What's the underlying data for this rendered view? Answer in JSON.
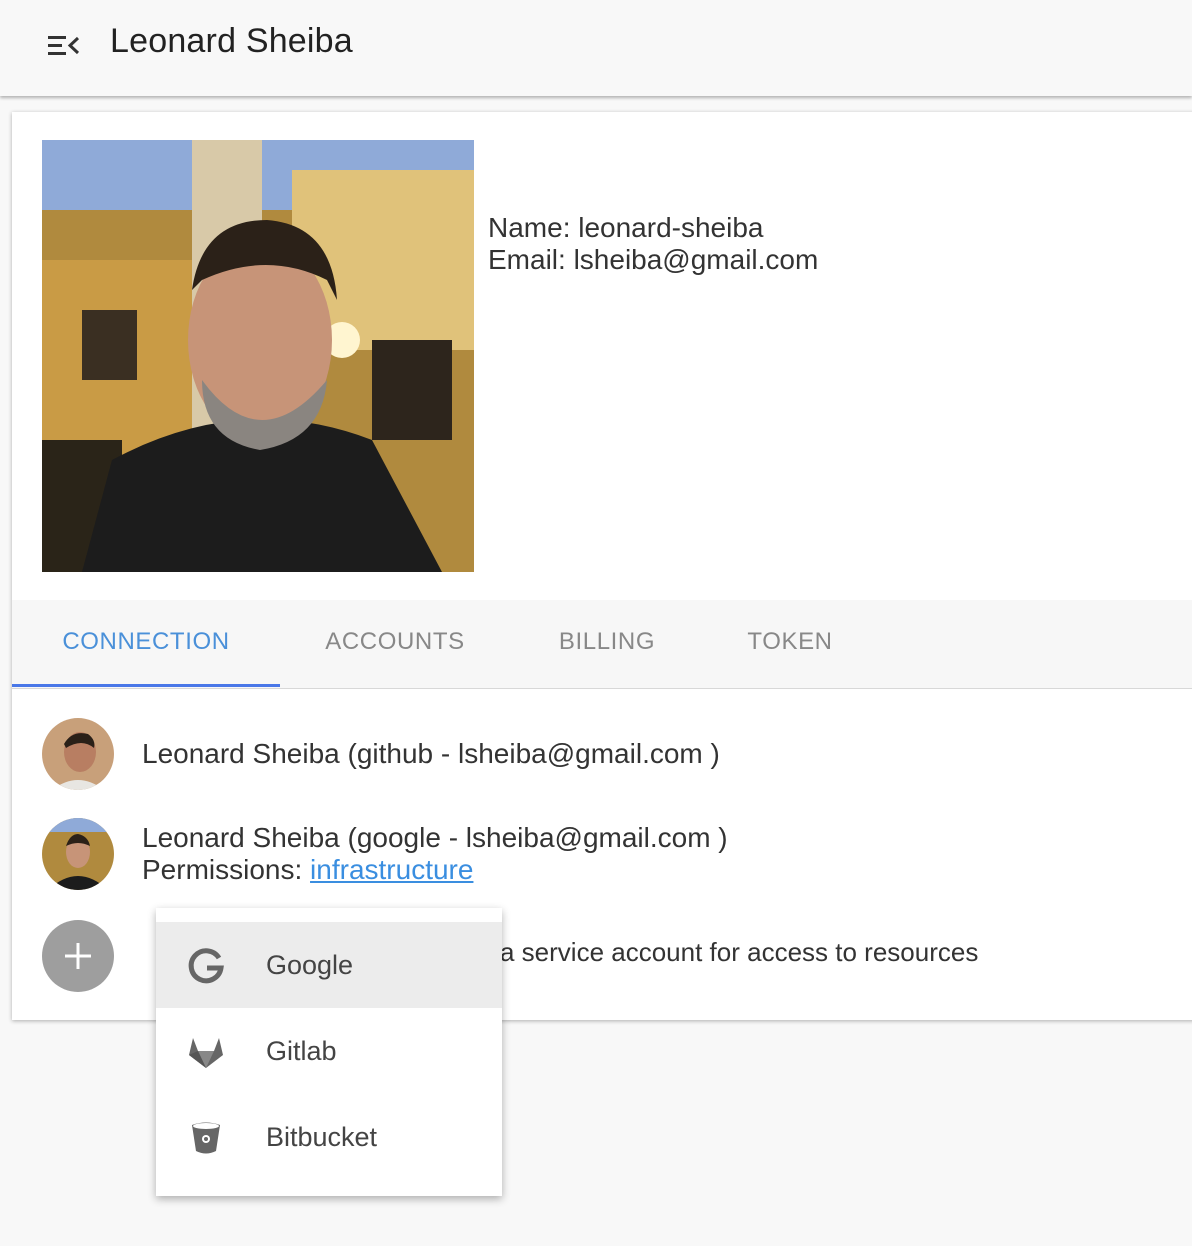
{
  "app": {
    "title": "Leonard Sheiba",
    "menu_icon": "menu-collapse-icon"
  },
  "profile": {
    "name_line": "Name: leonard-sheiba",
    "email_line": "Email: lsheiba@gmail.com"
  },
  "tabs": [
    {
      "label": "CONNECTION",
      "active": true
    },
    {
      "label": "ACCOUNTS",
      "active": false
    },
    {
      "label": "BILLING",
      "active": false
    },
    {
      "label": "TOKEN",
      "active": false
    }
  ],
  "connections": [
    {
      "line1": "Leonard Sheiba (github - lsheiba@gmail.com )"
    },
    {
      "line1": "Leonard Sheiba (google - lsheiba@gmail.com )",
      "permissions_label": "Permissions: ",
      "permissions_link": "infrastructure"
    }
  ],
  "add": {
    "icon": "plus-icon",
    "hint": "a service account for access to resources"
  },
  "menu": {
    "items": [
      {
        "label": "Google",
        "icon": "google-icon",
        "highlighted": true
      },
      {
        "label": "Gitlab",
        "icon": "gitlab-icon",
        "highlighted": false
      },
      {
        "label": "Bitbucket",
        "icon": "bitbucket-icon",
        "highlighted": false
      }
    ]
  },
  "colors": {
    "accent": "#4a90d9",
    "indicator": "#4a78e8",
    "link": "#3a8ee0",
    "fab": "#9e9e9e"
  }
}
